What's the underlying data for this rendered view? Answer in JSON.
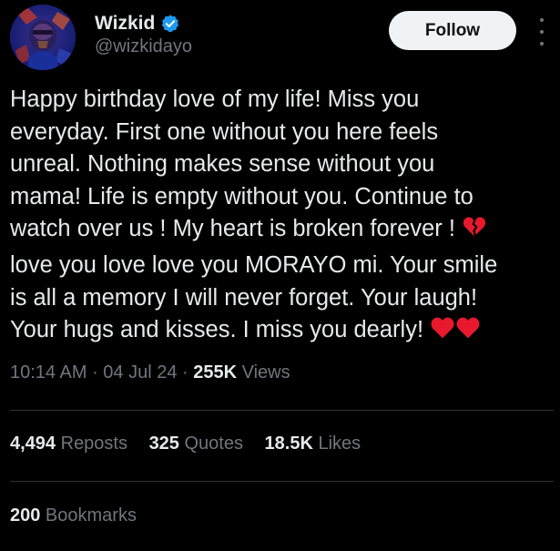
{
  "author": {
    "display_name": "Wizkid",
    "handle": "@wizkidayo",
    "verified_color": "#1d9bf0"
  },
  "actions": {
    "follow_label": "Follow",
    "more_icon": "more-vertical-icon"
  },
  "tweet": {
    "lines": [
      "Happy birthday love of my life! Miss you",
      "everyday. First one without you here feels",
      "unreal. Nothing makes sense without you",
      "mama! Life is empty without you. Continue to",
      "watch over us ! My heart is broken forever !",
      "love you love love you MORAYO mi. Your smile",
      "is all a memory I will never forget. Your laugh!",
      "Your hugs and kisses. I miss you dearly!"
    ],
    "emojis": {
      "line5": "broken-heart-emoji",
      "line8": [
        "red-heart-emoji",
        "red-heart-emoji"
      ]
    }
  },
  "meta": {
    "time": "10:14 AM",
    "separator": " · ",
    "date": "04 Jul 24",
    "views_count": "255K",
    "views_label": " Views"
  },
  "stats": {
    "reposts_count": "4,494",
    "reposts_label": " Reposts",
    "quotes_count": "325",
    "quotes_label": " Quotes",
    "likes_count": "18.5K",
    "likes_label": " Likes",
    "bookmarks_count": "200",
    "bookmarks_label": " Bookmarks"
  },
  "colors": {
    "background": "#000000",
    "text_primary": "#e7e9ea",
    "text_secondary": "#71767b",
    "divider": "#2f3336",
    "heart_red": "#e8192c"
  }
}
